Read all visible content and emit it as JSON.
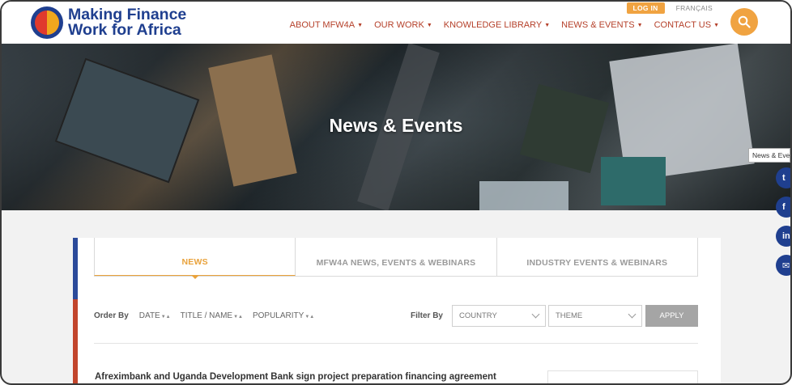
{
  "header": {
    "logo_line1": "Making Finance",
    "logo_line2": "Work for Africa",
    "login_label": "LOG IN",
    "language_label": "FRANÇAIS",
    "search_icon": "search-icon",
    "nav": [
      {
        "label": "ABOUT MFW4A",
        "caret": "▼"
      },
      {
        "label": "OUR WORK",
        "caret": "▼"
      },
      {
        "label": "KNOWLEDGE LIBRARY",
        "caret": "▼"
      },
      {
        "label": "NEWS & EVENTS",
        "caret": "▼"
      },
      {
        "label": "CONTACT US",
        "caret": "▼"
      }
    ]
  },
  "hero": {
    "title": "News & Events",
    "tooltip": "News & Events"
  },
  "social": {
    "twitter_glyph": "t",
    "facebook_glyph": "f",
    "linkedin_glyph": "in",
    "email_glyph": "✉"
  },
  "tabs": [
    {
      "label": "NEWS",
      "active": true
    },
    {
      "label": "MFW4A NEWS, EVENTS & WEBINARS",
      "active": false
    },
    {
      "label": "INDUSTRY EVENTS & WEBINARS",
      "active": false
    }
  ],
  "order": {
    "label": "Order By",
    "sort_arrows": "▼▲",
    "options": [
      "DATE",
      "TITLE / NAME",
      "POPULARITY"
    ]
  },
  "filter": {
    "label": "Filter By",
    "country_value": "COUNTRY",
    "theme_value": "THEME",
    "apply_label": "APPLY"
  },
  "articles": [
    {
      "title": "Afreximbank and Uganda Development Bank sign project preparation financing agreement"
    }
  ],
  "colors": {
    "brand_blue": "#1f3f8f",
    "brand_orange": "#f0a341",
    "nav_red": "#b5402a"
  }
}
